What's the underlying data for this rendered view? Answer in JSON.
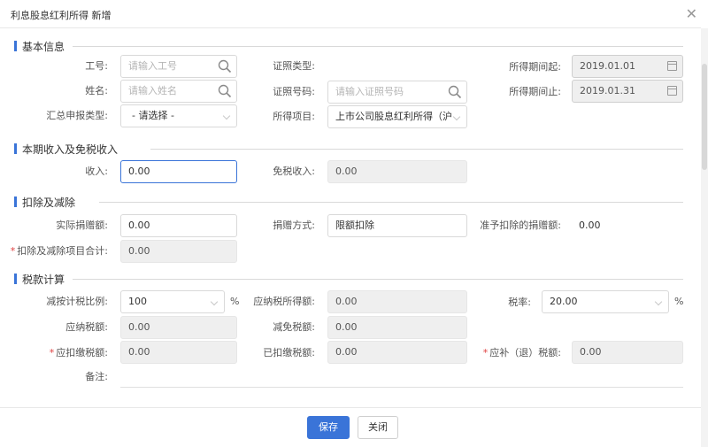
{
  "dialog": {
    "title": "利息股息红利所得 新增",
    "close_glyph": "✕"
  },
  "sections": {
    "basic": "基本信息",
    "income": "本期收入及免税收入",
    "deduction": "扣除及减除",
    "tax": "税款计算"
  },
  "basic": {
    "employee_id": {
      "label": "工号:",
      "placeholder": "请输入工号"
    },
    "name": {
      "label": "姓名:",
      "placeholder": "请输入姓名"
    },
    "report_type": {
      "label": "汇总申报类型:",
      "value": "- 请选择 -"
    },
    "id_type": {
      "label": "证照类型:",
      "value": ""
    },
    "id_number": {
      "label": "证照号码:",
      "placeholder": "请输入证照号码"
    },
    "income_item": {
      "label": "所得项目:",
      "value": "上市公司股息红利所得（沪"
    },
    "period_start": {
      "label": "所得期间起:",
      "value": "2019.01.01"
    },
    "period_end": {
      "label": "所得期间止:",
      "value": "2019.01.31"
    }
  },
  "income": {
    "income": {
      "label": "收入:",
      "value": "0.00"
    },
    "tax_free": {
      "label": "免税收入:",
      "value": "0.00"
    }
  },
  "deduction": {
    "actual_donation": {
      "label": "实际捐赠额:",
      "value": "0.00"
    },
    "donation_method": {
      "label": "捐赠方式:",
      "value": "限额扣除"
    },
    "allowed_donation": {
      "label": "准予扣除的捐赠额:",
      "value": "0.00"
    },
    "total": {
      "label": "扣除及减除项目合计:",
      "value": "0.00"
    }
  },
  "tax": {
    "ratio": {
      "label": "减按计税比例:",
      "value": "100",
      "unit": "%"
    },
    "taxable_income": {
      "label": "应纳税所得额:",
      "value": "0.00"
    },
    "rate": {
      "label": "税率:",
      "value": "20.00",
      "unit": "%"
    },
    "tax_payable": {
      "label": "应纳税额:",
      "value": "0.00"
    },
    "tax_relief": {
      "label": "减免税额:",
      "value": "0.00"
    },
    "withholding": {
      "label": "应扣缴税额:",
      "value": "0.00"
    },
    "withheld": {
      "label": "已扣缴税额:",
      "value": "0.00"
    },
    "refund": {
      "label": "应补（退）税额:",
      "value": "0.00"
    },
    "remark": {
      "label": "备注:"
    }
  },
  "footer": {
    "save": "保存",
    "close": "关闭"
  },
  "colors": {
    "primary": "#3a74d8",
    "required": "#e04040",
    "disabled_bg": "#efefef"
  },
  "icons": {
    "search": "search-icon",
    "calendar": "calendar-icon",
    "close": "close-icon"
  }
}
